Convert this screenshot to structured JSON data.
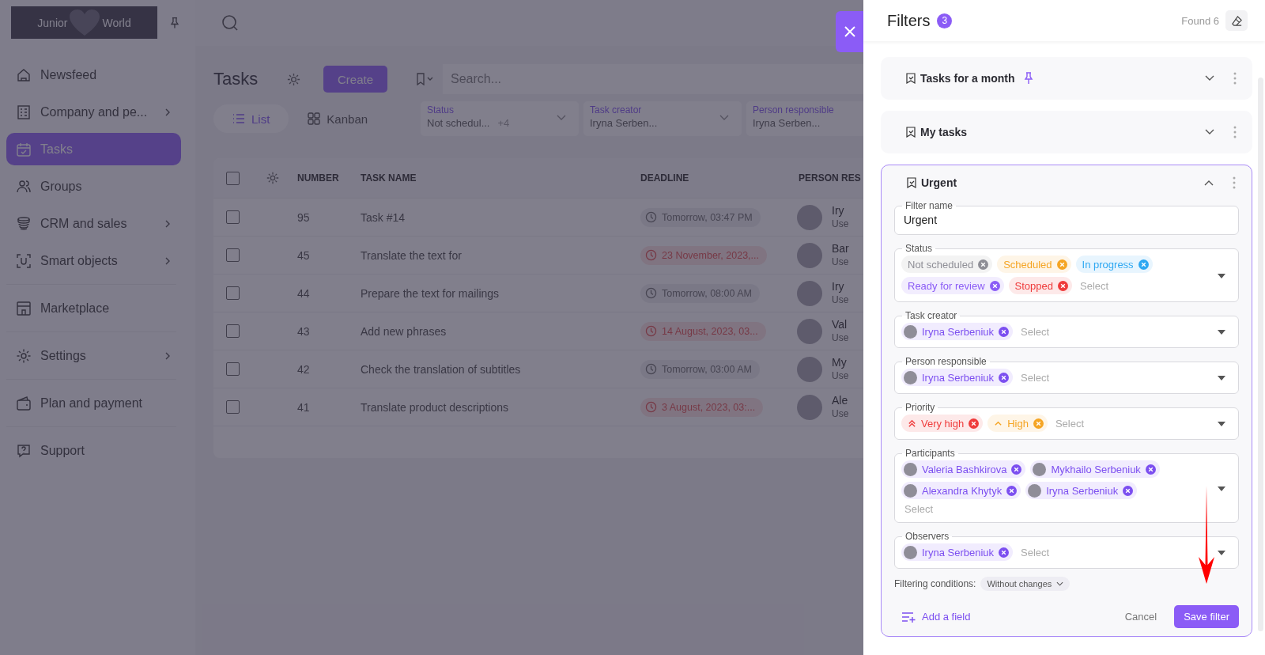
{
  "sidebar": {
    "logo": {
      "left": "Junior",
      "right": "World"
    },
    "groups": [
      {
        "items": [
          {
            "label": "Newsfeed",
            "selected": false,
            "has_submenu": false
          },
          {
            "label": "Company and pe...",
            "selected": false,
            "has_submenu": true
          },
          {
            "label": "Tasks",
            "selected": true,
            "has_submenu": false
          },
          {
            "label": "Groups",
            "selected": false,
            "has_submenu": false
          },
          {
            "label": "CRM and sales",
            "selected": false,
            "has_submenu": true
          },
          {
            "label": "Smart objects",
            "selected": false,
            "has_submenu": true
          }
        ]
      },
      {
        "items": [
          {
            "label": "Marketplace",
            "selected": false,
            "has_submenu": false
          }
        ]
      },
      {
        "items": [
          {
            "label": "Settings",
            "selected": false,
            "has_submenu": true
          }
        ]
      },
      {
        "items": [
          {
            "label": "Plan and payment",
            "selected": false,
            "has_submenu": false
          }
        ]
      },
      {
        "items": [
          {
            "label": "Support",
            "selected": false,
            "has_submenu": false
          }
        ]
      }
    ]
  },
  "page": {
    "title": "Tasks",
    "create_button": "Create",
    "search": {
      "placeholder": "Search..."
    },
    "view_tabs": [
      {
        "label": "List",
        "selected": true
      },
      {
        "label": "Kanban",
        "selected": false
      }
    ],
    "quick_filters": [
      {
        "label": "Status",
        "value": "Not schedul...",
        "extra": "+4"
      },
      {
        "label": "Task creator",
        "value": "Iryna Serben..."
      },
      {
        "label": "Person responsible",
        "value": "Iryna Serben..."
      }
    ]
  },
  "table": {
    "all_checked": false,
    "columns": [
      "NUMBER",
      "TASK NAME",
      "DEADLINE",
      "PERSON RES"
    ],
    "rows": [
      {
        "checked": false,
        "number": "95",
        "name": "Task #14",
        "deadline": "Tomorrow, 03:47 PM",
        "overdue": false,
        "person": "Iry",
        "role": "Use"
      },
      {
        "checked": false,
        "number": "45",
        "name": "Translate the text for",
        "deadline": "23 November, 2023,...",
        "overdue": true,
        "person": "Bar",
        "role": "Use"
      },
      {
        "checked": false,
        "number": "44",
        "name": "Prepare the text for mailings",
        "deadline": "Tomorrow, 08:00 AM",
        "overdue": false,
        "person": "Iry",
        "role": "Use"
      },
      {
        "checked": false,
        "number": "43",
        "name": "Add new phrases",
        "deadline": "14 August, 2023, 03...",
        "overdue": true,
        "person": "Val",
        "role": "Use"
      },
      {
        "checked": false,
        "number": "42",
        "name": "Check the translation of subtitles",
        "deadline": "Tomorrow, 03:00 AM",
        "overdue": false,
        "person": "My",
        "role": "Use"
      },
      {
        "checked": false,
        "number": "41",
        "name": "Translate product descriptions",
        "deadline": "3 August, 2023, 03:...",
        "overdue": true,
        "person": "Ale",
        "role": "Use"
      }
    ]
  },
  "filters_panel": {
    "title": "Filters",
    "count": "3",
    "found": "Found 6",
    "saved_filters": [
      {
        "name": "Tasks for a month",
        "pinned": true,
        "expanded": false
      },
      {
        "name": "My tasks",
        "pinned": false,
        "expanded": false
      },
      {
        "name": "Urgent",
        "pinned": false,
        "expanded": true,
        "fields": [
          {
            "kind": "text",
            "label": "Filter name",
            "value": "Urgent"
          },
          {
            "kind": "chips",
            "label": "Status",
            "placeholder": "Select",
            "chips": [
              {
                "kind": "status",
                "label": "Not scheduled",
                "color": "#8e8e96"
              },
              {
                "kind": "status",
                "label": "Scheduled",
                "color": "#f5a524"
              },
              {
                "kind": "status",
                "label": "In progress",
                "color": "#2ea8f2"
              },
              {
                "kind": "status",
                "label": "Ready for review",
                "color": "#8b5cf6"
              },
              {
                "kind": "status",
                "label": "Stopped",
                "color": "#ef3b3b"
              }
            ]
          },
          {
            "kind": "chips",
            "label": "Task creator",
            "placeholder": "Select",
            "chips": [
              {
                "kind": "person",
                "label": "Iryna Serbeniuk"
              }
            ]
          },
          {
            "kind": "chips",
            "label": "Person responsible",
            "placeholder": "Select",
            "chips": [
              {
                "kind": "person",
                "label": "Iryna Serbeniuk"
              }
            ]
          },
          {
            "kind": "chips",
            "label": "Priority",
            "placeholder": "Select",
            "chips": [
              {
                "kind": "priority",
                "label": "Very high",
                "color": "#ef3b3b"
              },
              {
                "kind": "priority",
                "label": "High",
                "color": "#f5a524"
              }
            ]
          },
          {
            "kind": "chips",
            "label": "Participants",
            "placeholder": "Select",
            "chips": [
              {
                "kind": "person",
                "label": "Valeria Bashkirova"
              },
              {
                "kind": "person",
                "label": "Mykhailo Serbeniuk"
              },
              {
                "kind": "person",
                "label": "Alexandra Khytyk"
              },
              {
                "kind": "person",
                "label": "Iryna Serbeniuk"
              }
            ]
          },
          {
            "kind": "chips",
            "label": "Observers",
            "placeholder": "Select",
            "chips": [
              {
                "kind": "person",
                "label": "Iryna Serbeniuk"
              }
            ]
          }
        ],
        "conditions_label": "Filtering conditions:",
        "conditions_value": "Without changes",
        "add_field": "Add a field",
        "cancel": "Cancel",
        "save": "Save filter"
      }
    ]
  },
  "annotation_arrow": true
}
